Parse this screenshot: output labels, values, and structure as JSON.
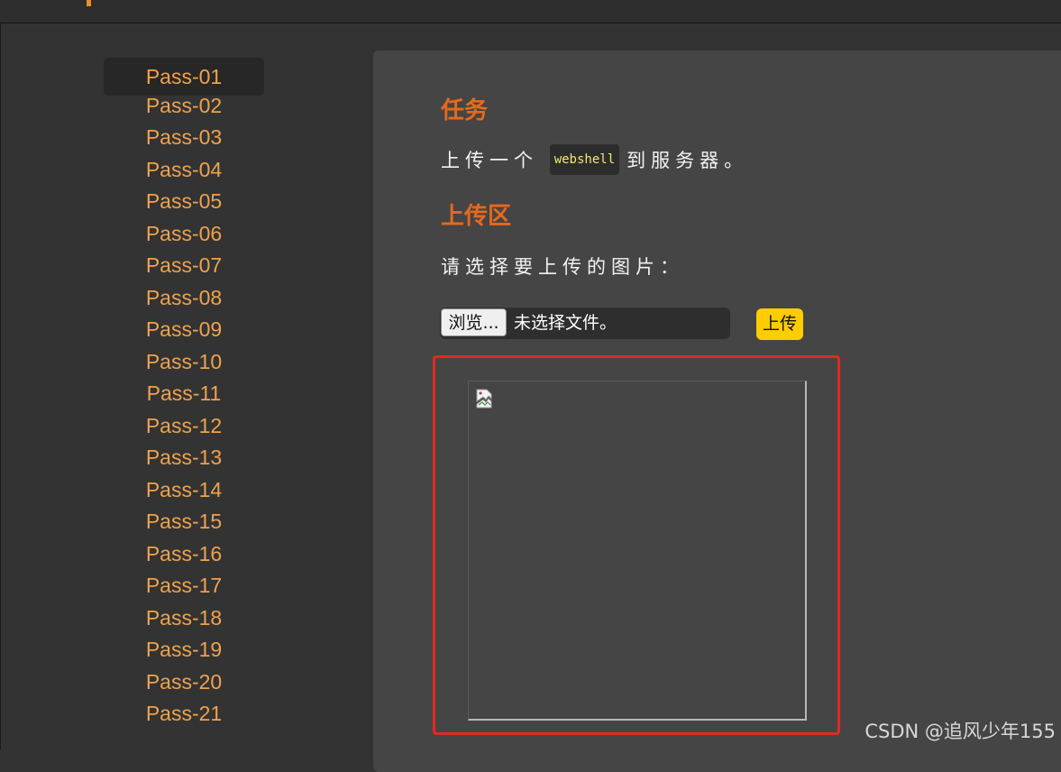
{
  "sidebar": {
    "items": [
      {
        "label": "Pass-01"
      },
      {
        "label": "Pass-02"
      },
      {
        "label": "Pass-03"
      },
      {
        "label": "Pass-04"
      },
      {
        "label": "Pass-05"
      },
      {
        "label": "Pass-06"
      },
      {
        "label": "Pass-07"
      },
      {
        "label": "Pass-08"
      },
      {
        "label": "Pass-09"
      },
      {
        "label": "Pass-10"
      },
      {
        "label": "Pass-11"
      },
      {
        "label": "Pass-12"
      },
      {
        "label": "Pass-13"
      },
      {
        "label": "Pass-14"
      },
      {
        "label": "Pass-15"
      },
      {
        "label": "Pass-16"
      },
      {
        "label": "Pass-17"
      },
      {
        "label": "Pass-18"
      },
      {
        "label": "Pass-19"
      },
      {
        "label": "Pass-20"
      },
      {
        "label": "Pass-21"
      }
    ],
    "active_index": 0
  },
  "task": {
    "heading": "任务",
    "text_before": "上传一个",
    "code": "webshell",
    "text_after": "到服务器。"
  },
  "upload": {
    "heading": "上传区",
    "prompt": "请选择要上传的图片：",
    "browse_label": "浏览...",
    "file_status": "未选择文件。",
    "submit_label": "上传"
  },
  "preview": {
    "image_icon": "broken-image-icon"
  },
  "watermark": "CSDN @追风少年155",
  "colors": {
    "accent_orange": "#f0a24c",
    "heading_orange": "#e8681c",
    "upload_button": "#ffcc00",
    "highlight_frame": "#e02a20"
  }
}
